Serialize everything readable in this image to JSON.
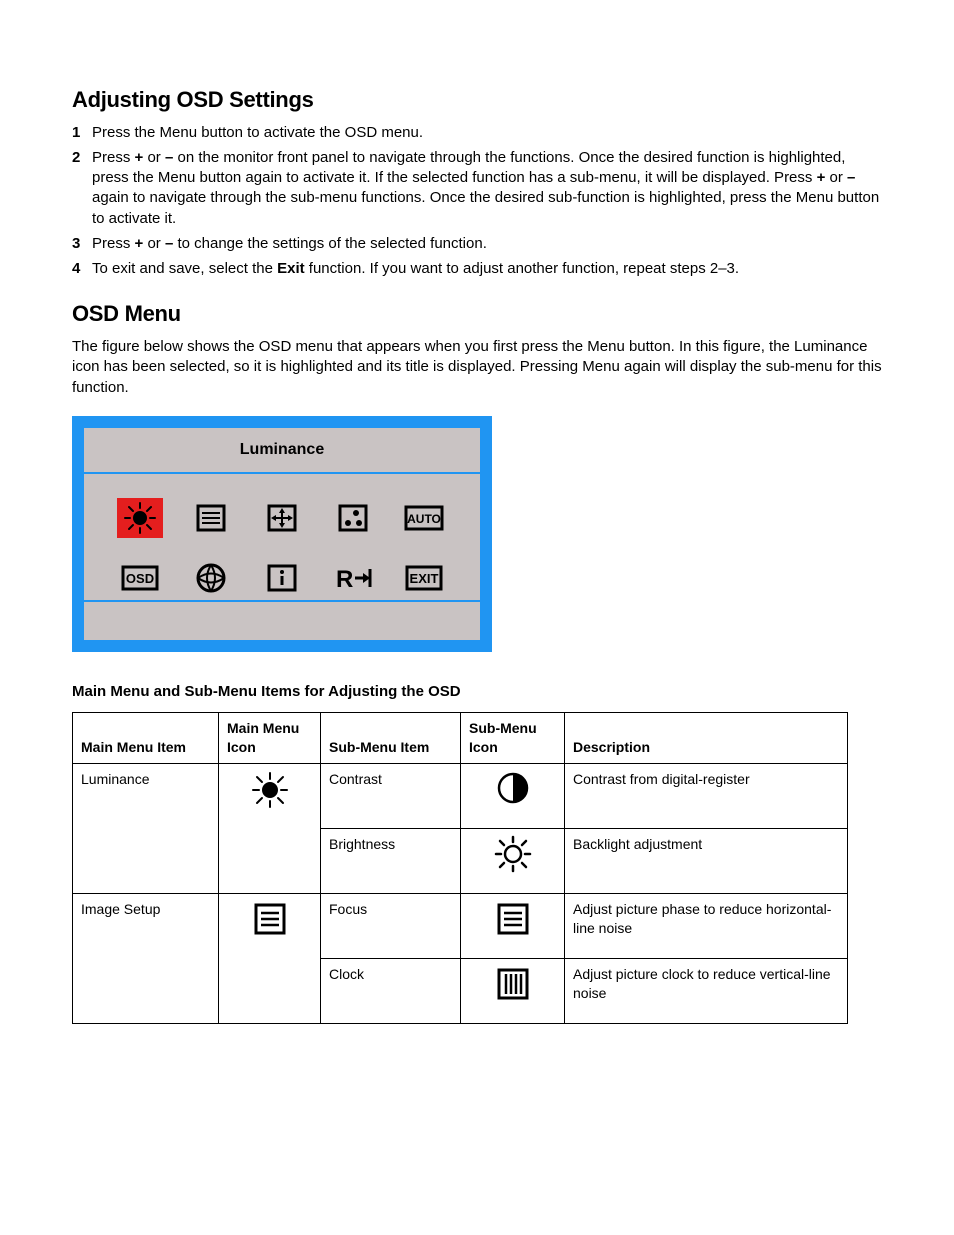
{
  "section1": {
    "title": "Adjusting OSD Settings",
    "steps": {
      "s1": {
        "num": "1",
        "text": "Press the Menu button to activate the OSD menu."
      },
      "s2": {
        "num": "2",
        "pre": "Press ",
        "plus": "+",
        "mid1": " or ",
        "minus": "–",
        "mid2": " on the monitor front panel to navigate through the functions. Once the desired function is highlighted, press the Menu button again to activate it. If the selected function has a sub-menu, it will be displayed. Press ",
        "plus2": "+",
        "mid3": " or ",
        "minus2": "–",
        "post": " again to navigate through the sub-menu functions. Once the desired sub-function is highlighted, press the Menu button to activate it."
      },
      "s3": {
        "num": "3",
        "pre": "Press ",
        "plus": "+",
        "mid1": " or ",
        "minus": "–",
        "post": " to change the settings of the selected function."
      },
      "s4": {
        "num": "4",
        "pre": "To exit and save, select the ",
        "exit": "Exit",
        "post": " function. If you want to adjust another function, repeat steps 2–3."
      }
    }
  },
  "section2": {
    "title": "OSD Menu",
    "intro": "The figure below shows the OSD menu that appears when you first press the Menu button. In this figure, the Luminance icon has been selected, so it is highlighted and its title is displayed. Pressing Menu again will display the sub-menu for this function."
  },
  "osd": {
    "header": "Luminance",
    "labels": {
      "auto": "AUTO",
      "osd": "OSD",
      "exit": "EXIT"
    }
  },
  "table": {
    "title": "Main Menu and Sub-Menu Items for Adjusting the OSD",
    "headers": {
      "h1": "Main Menu Item",
      "h2": "Main Menu Icon",
      "h3": "Sub-Menu Item",
      "h4": "Sub-Menu Icon",
      "h5": "Description"
    },
    "rows": {
      "r1": {
        "main": "Luminance",
        "sub": "Contrast",
        "desc": "Contrast from digital-register"
      },
      "r2": {
        "sub": "Brightness",
        "desc": "Backlight adjustment"
      },
      "r3": {
        "main": "Image Setup",
        "sub": "Focus",
        "desc": "Adjust picture phase to reduce horizontal-line noise"
      },
      "r4": {
        "sub": "Clock",
        "desc": "Adjust picture clock to reduce vertical-line noise"
      }
    }
  }
}
